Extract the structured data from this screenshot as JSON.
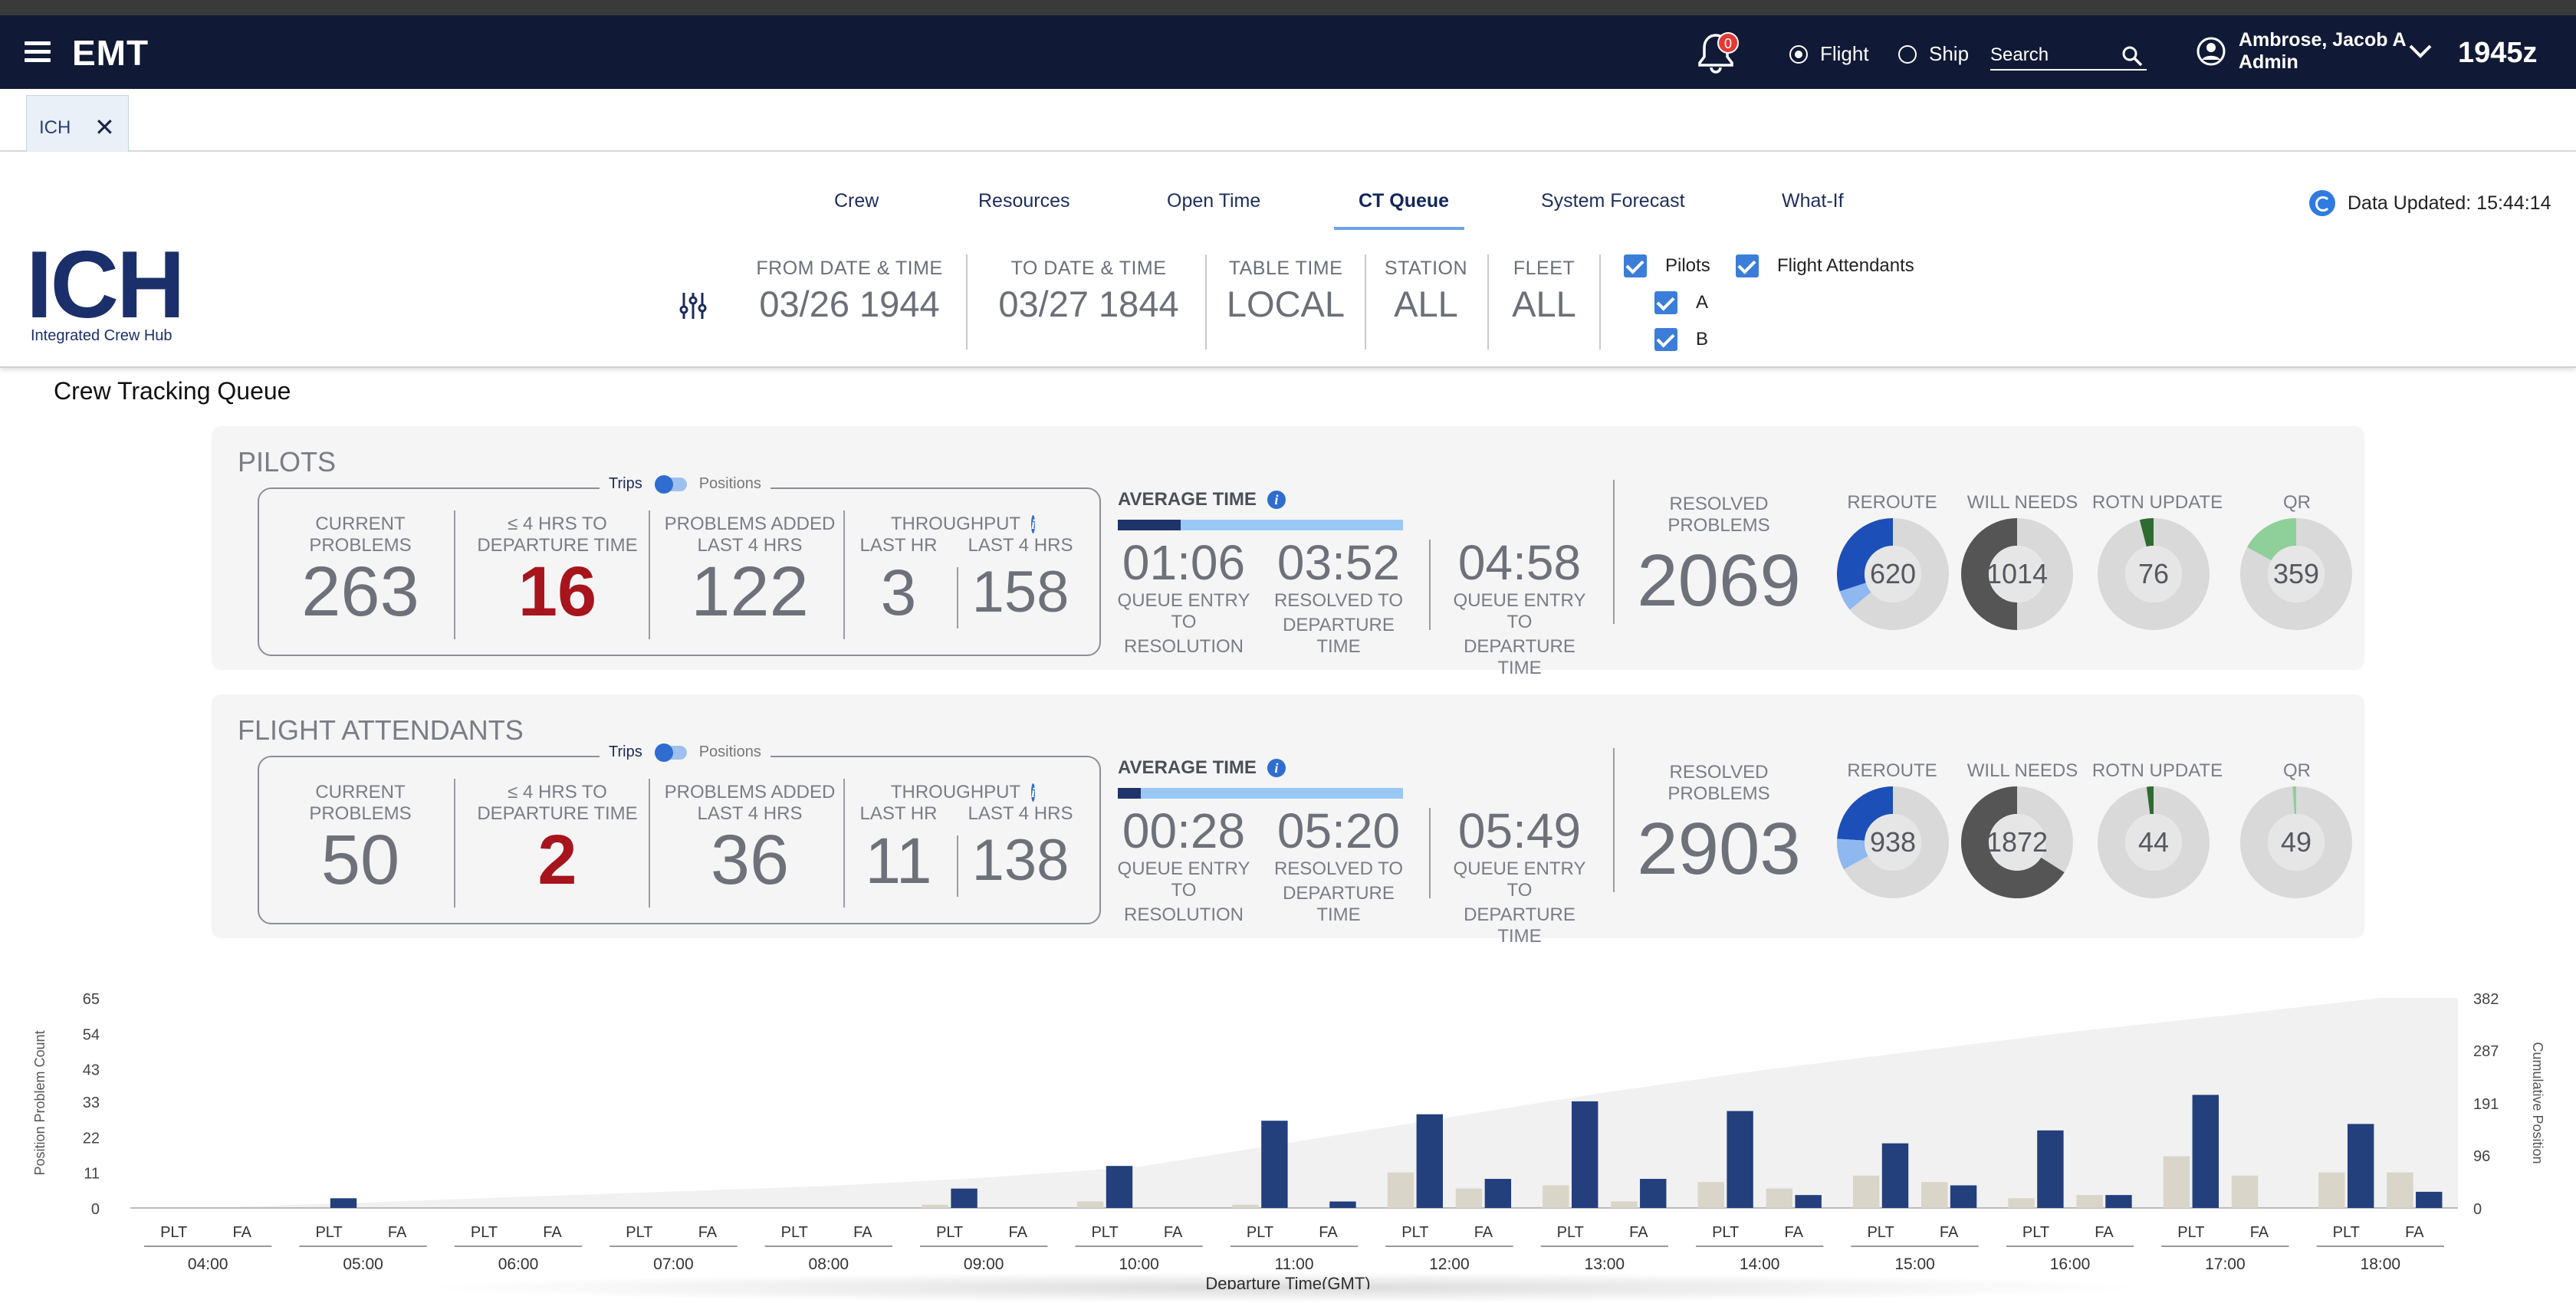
{
  "app": {
    "brand": "EMT",
    "notification_count": "0",
    "zulu_time": "1945z"
  },
  "mode": {
    "options": [
      "Flight",
      "Ship"
    ],
    "selected": "Flight"
  },
  "search": {
    "placeholder": "Search"
  },
  "user": {
    "name": "Ambrose, Jacob A",
    "role": "Admin"
  },
  "open_tab": {
    "label": "ICH",
    "close": "✕"
  },
  "logo": {
    "title": "ICH",
    "subtitle": "Integrated Crew Hub"
  },
  "nav": {
    "items": [
      "Crew",
      "Resources",
      "Open Time",
      "CT Queue",
      "System Forecast",
      "What-If"
    ],
    "active": "CT Queue"
  },
  "data_updated": "Data Updated: 15:44:14",
  "filters": {
    "from": {
      "label": "FROM DATE & TIME",
      "value": "03/26 1944"
    },
    "to": {
      "label": "TO DATE & TIME",
      "value": "03/27 1844"
    },
    "table_time": {
      "label": "TABLE TIME",
      "value": "LOCAL"
    },
    "station": {
      "label": "STATION",
      "value": "ALL"
    },
    "fleet": {
      "label": "FLEET",
      "value": "ALL"
    }
  },
  "checkboxes": {
    "pilots": "Pilots",
    "a": "A",
    "b": "B",
    "flight_attendants": "Flight Attendants"
  },
  "section_title": "Crew Tracking Queue",
  "labels": {
    "trips": "Trips",
    "positions": "Positions",
    "current_problems": [
      "CURRENT",
      "PROBLEMS"
    ],
    "within_4": [
      "≤ 4 HRS TO",
      "DEPARTURE TIME"
    ],
    "problems_added": [
      "PROBLEMS ADDED",
      "LAST 4 HRS"
    ],
    "throughput": "THROUGHPUT",
    "last_hr": "LAST HR",
    "last_4hrs": "LAST 4 HRS",
    "average_time": "AVERAGE TIME",
    "qe_resolution": [
      "QUEUE ENTRY TO",
      "RESOLUTION"
    ],
    "res_departure": [
      "RESOLVED TO",
      "DEPARTURE TIME"
    ],
    "qe_departure": [
      "QUEUE ENTRY TO",
      "DEPARTURE TIME"
    ],
    "resolved_problems": [
      "RESOLVED",
      "PROBLEMS"
    ],
    "reroute": "REROUTE",
    "will_needs": "WILL NEEDS",
    "rotn_update": "ROTN UPDATE",
    "qr": "QR"
  },
  "pilots": {
    "title": "PILOTS",
    "current_problems": "263",
    "within_4_hrs": "16",
    "problems_added": "122",
    "throughput_last_hr": "3",
    "throughput_last_4hrs": "158",
    "avg_bar_fraction": 0.22,
    "avg_qe_resolution": "01:06",
    "avg_resolved_departure": "03:52",
    "avg_qe_departure": "04:58",
    "resolved_problems": "2069",
    "donuts": [
      {
        "value": "620",
        "fraction": 0.3,
        "color": "#1d4fb8",
        "accent": "#8fb8f0",
        "accent_fraction": 0.06
      },
      {
        "value": "1014",
        "fraction": 0.5,
        "color": "#555555"
      },
      {
        "value": "76",
        "fraction": 0.04,
        "color": "#2e6b2e"
      },
      {
        "value": "359",
        "fraction": 0.17,
        "color": "#8fcf9a"
      }
    ]
  },
  "fa": {
    "title": "FLIGHT ATTENDANTS",
    "current_problems": "50",
    "within_4_hrs": "2",
    "problems_added": "36",
    "throughput_last_hr": "11",
    "throughput_last_4hrs": "138",
    "avg_bar_fraction": 0.08,
    "avg_qe_resolution": "00:28",
    "avg_resolved_departure": "05:20",
    "avg_qe_departure": "05:49",
    "resolved_problems": "2903",
    "donuts": [
      {
        "value": "938",
        "fraction": 0.24,
        "color": "#1d4fb8",
        "accent": "#8fb8f0",
        "accent_fraction": 0.09
      },
      {
        "value": "1872",
        "fraction": 0.66,
        "color": "#555555"
      },
      {
        "value": "44",
        "fraction": 0.02,
        "color": "#2e6b2e"
      },
      {
        "value": "49",
        "fraction": 0.01,
        "color": "#8fcf9a"
      }
    ]
  },
  "chart_data": {
    "type": "bar",
    "ylabel": "Position Problem Count",
    "y2label": "Cumulative Position",
    "xlabel": "Departure Time(GMT)",
    "yticks": [
      "0",
      "11",
      "22",
      "33",
      "43",
      "54",
      "65"
    ],
    "y2ticks": [
      "0",
      "96",
      "191",
      "287",
      "382"
    ],
    "ylim": [
      0,
      65
    ],
    "y2lim": [
      0,
      382
    ],
    "categories": [
      "04:00",
      "05:00",
      "06:00",
      "07:00",
      "08:00",
      "09:00",
      "10:00",
      "11:00",
      "12:00",
      "13:00",
      "14:00",
      "15:00",
      "16:00",
      "17:00",
      "18:00"
    ],
    "group_labels": [
      "PLT",
      "FA"
    ],
    "series": [
      {
        "name": "PLT",
        "color": "#233f7c",
        "values": [
          0,
          3,
          0,
          0,
          0,
          6,
          13,
          27,
          29,
          33,
          30,
          20,
          24,
          35,
          26
        ]
      },
      {
        "name": "PLT secondary",
        "color": "#d9d5c9",
        "values": [
          0,
          0,
          0,
          0,
          0,
          1,
          2,
          1,
          11,
          7,
          8,
          10,
          3,
          16,
          11
        ]
      },
      {
        "name": "FA",
        "color": "#233f7c",
        "values": [
          0,
          0,
          0,
          0,
          0,
          0,
          0,
          2,
          9,
          9,
          4,
          7,
          4,
          0,
          5
        ]
      },
      {
        "name": "FA secondary",
        "color": "#d9d5c9",
        "values": [
          0,
          0,
          0,
          0,
          0,
          0,
          0,
          0,
          6,
          2,
          6,
          8,
          4,
          10,
          11
        ]
      }
    ],
    "cumulative": [
      0,
      10,
      20,
      30,
      40,
      55,
      75,
      120,
      165,
      210,
      250,
      285,
      320,
      350,
      382
    ]
  }
}
